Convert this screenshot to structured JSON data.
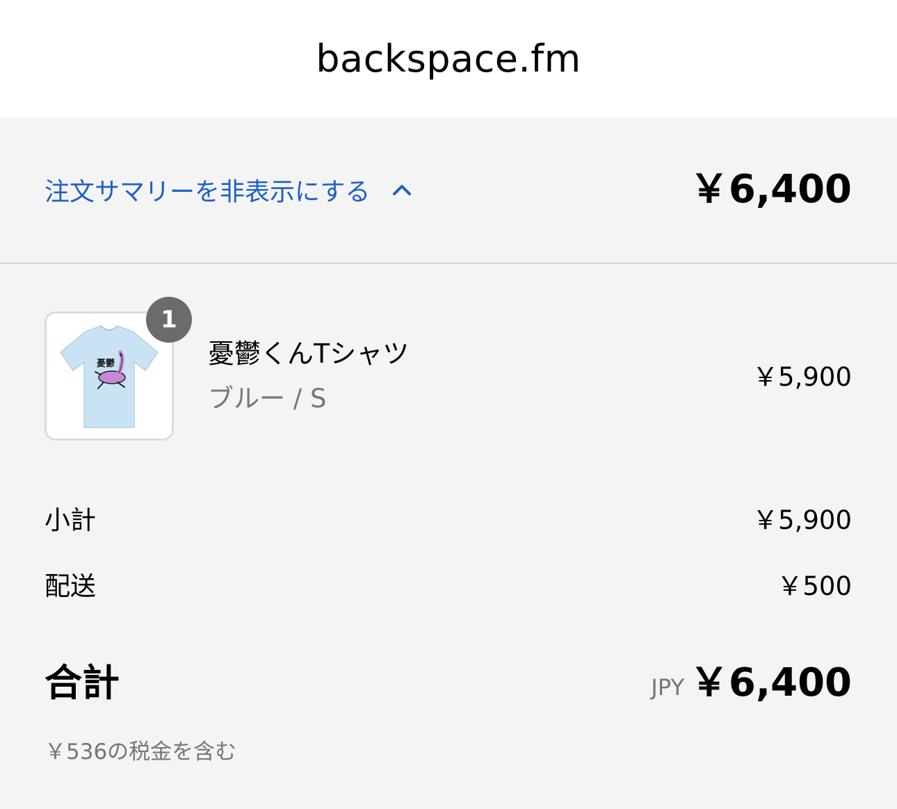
{
  "header": {
    "site_title": "backspace.fm"
  },
  "summary": {
    "toggle_label": "注文サマリーを非表示にする",
    "header_total": "￥6,400"
  },
  "cart": {
    "items": [
      {
        "quantity": "1",
        "name": "憂鬱くんTシャツ",
        "variant": "ブルー / S",
        "price": "￥5,900",
        "image_icon": "tshirt-image"
      }
    ]
  },
  "costs": {
    "subtotal_label": "小計",
    "subtotal_value": "￥5,900",
    "shipping_label": "配送",
    "shipping_value": "￥500",
    "total_label": "合計",
    "currency": "JPY",
    "total_value": "￥6,400",
    "tax_note": "￥536の税金を含む"
  },
  "colors": {
    "link": "#1f5fc7",
    "background": "#f4f4f4",
    "badge": "#6b6b6b",
    "muted_text": "#777777",
    "shirt": "#c9e3f5"
  }
}
